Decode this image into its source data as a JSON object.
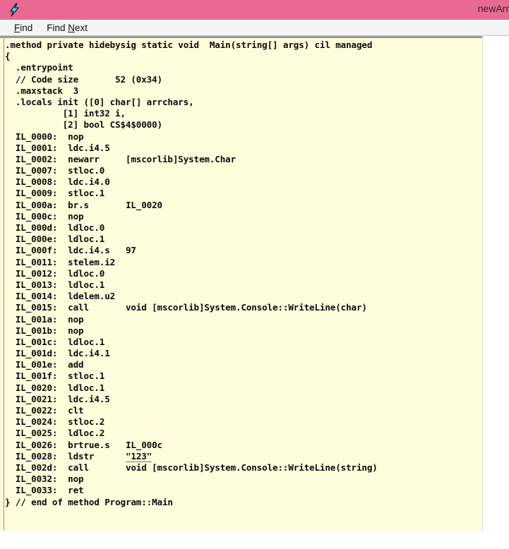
{
  "window": {
    "title": "newArr",
    "icon": "ildasm-lightning-icon",
    "titlebar_color": "#e86a92",
    "code_background": "#fdfddc",
    "code_text_color": "#0b0b0b"
  },
  "menubar": {
    "items": [
      {
        "name": "find",
        "label": "Find",
        "accel_char": "F"
      },
      {
        "name": "find-next",
        "label": "Find Next",
        "accel_char": "N"
      }
    ]
  },
  "code": {
    "language": "cil",
    "highlighted_token": "\"123\"",
    "lines": [
      ".method private hidebysig static void  Main(string[] args) cil managed",
      "{",
      "  .entrypoint",
      "  // Code size       52 (0x34)",
      "  .maxstack  3",
      "  .locals init ([0] char[] arrchars,",
      "           [1] int32 i,",
      "           [2] bool CS$4$0000)",
      "  IL_0000:  nop",
      "  IL_0001:  ldc.i4.5",
      "  IL_0002:  newarr     [mscorlib]System.Char",
      "  IL_0007:  stloc.0",
      "  IL_0008:  ldc.i4.0",
      "  IL_0009:  stloc.1",
      "  IL_000a:  br.s       IL_0020",
      "  IL_000c:  nop",
      "  IL_000d:  ldloc.0",
      "  IL_000e:  ldloc.1",
      "  IL_000f:  ldc.i4.s   97",
      "  IL_0011:  stelem.i2",
      "  IL_0012:  ldloc.0",
      "  IL_0013:  ldloc.1",
      "  IL_0014:  ldelem.u2",
      "  IL_0015:  call       void [mscorlib]System.Console::WriteLine(char)",
      "  IL_001a:  nop",
      "  IL_001b:  nop",
      "  IL_001c:  ldloc.1",
      "  IL_001d:  ldc.i4.1",
      "  IL_001e:  add",
      "  IL_001f:  stloc.1",
      "  IL_0020:  ldloc.1",
      "  IL_0021:  ldc.i4.5",
      "  IL_0022:  clt",
      "  IL_0024:  stloc.2",
      "  IL_0025:  ldloc.2",
      "  IL_0026:  brtrue.s   IL_000c",
      "  IL_0028:  ldstr      \"123\"",
      "  IL_002d:  call       void [mscorlib]System.Console::WriteLine(string)",
      "  IL_0032:  nop",
      "  IL_0033:  ret",
      "} // end of method Program::Main"
    ]
  }
}
